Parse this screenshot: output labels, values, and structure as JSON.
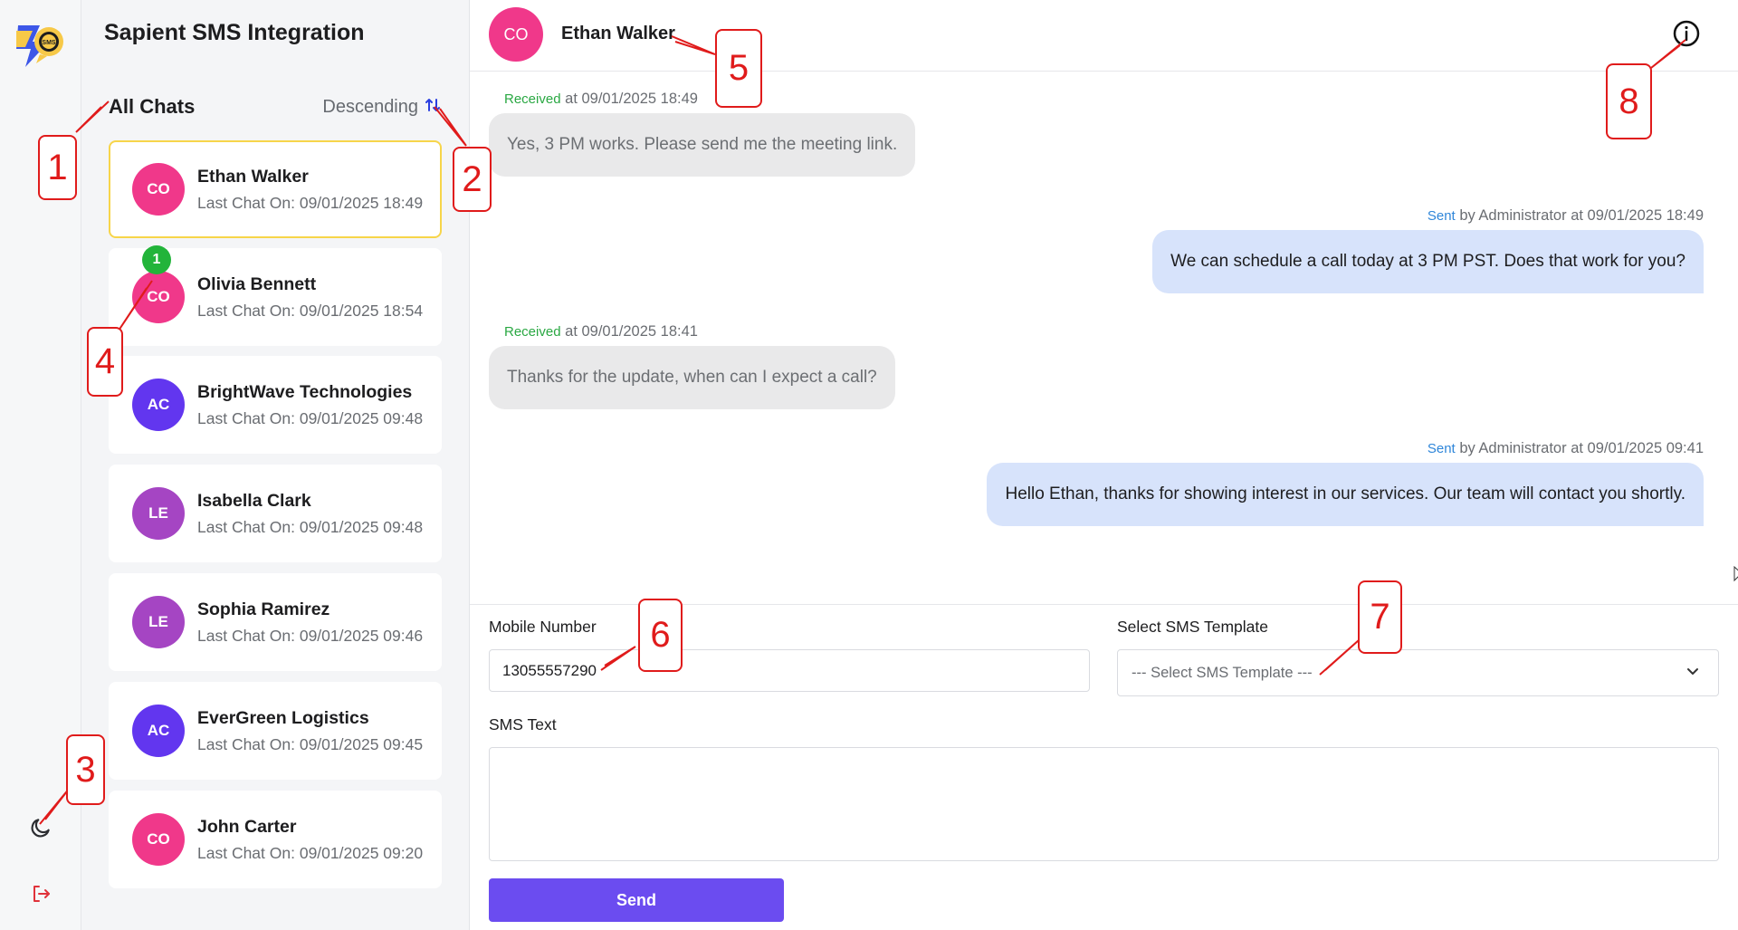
{
  "app": {
    "title": "Sapient SMS Integration",
    "logo_text": "SMS"
  },
  "rail": {
    "theme_icon": "moon-icon",
    "logout_icon": "logout-icon"
  },
  "list": {
    "heading": "All Chats",
    "sort_label": "Descending",
    "sort_icon": "sort-arrows-icon",
    "chats": [
      {
        "initials": "CO",
        "name": "Ethan Walker",
        "last": "Last Chat On: 09/01/2025 18:49",
        "color": "#f0388a",
        "active": true,
        "unread": ""
      },
      {
        "initials": "CO",
        "name": "Olivia Bennett",
        "last": "Last Chat On: 09/01/2025 18:54",
        "color": "#f0388a",
        "active": false,
        "unread": "1"
      },
      {
        "initials": "AC",
        "name": "BrightWave Technologies",
        "last": "Last Chat On: 09/01/2025 09:48",
        "color": "#6236ef",
        "active": false,
        "unread": ""
      },
      {
        "initials": "LE",
        "name": "Isabella Clark",
        "last": "Last Chat On: 09/01/2025 09:48",
        "color": "#a545c3",
        "active": false,
        "unread": ""
      },
      {
        "initials": "LE",
        "name": "Sophia Ramirez",
        "last": "Last Chat On: 09/01/2025 09:46",
        "color": "#a545c3",
        "active": false,
        "unread": ""
      },
      {
        "initials": "AC",
        "name": "EverGreen Logistics",
        "last": "Last Chat On: 09/01/2025 09:45",
        "color": "#6236ef",
        "active": false,
        "unread": ""
      },
      {
        "initials": "CO",
        "name": "John Carter",
        "last": "Last Chat On: 09/01/2025 09:20",
        "color": "#f0388a",
        "active": false,
        "unread": ""
      }
    ]
  },
  "conversation": {
    "contact_initials": "CO",
    "contact_name": "Ethan Walker",
    "info_icon": "info-icon",
    "messages": [
      {
        "direction": "in",
        "status": "Received",
        "meta": "at 09/01/2025 18:49",
        "text": "Yes, 3 PM works. Please send me the meeting link."
      },
      {
        "direction": "out",
        "status": "Sent",
        "meta": "by Administrator at 09/01/2025 18:49",
        "text": "We can schedule a call today at 3 PM PST. Does that work for you?"
      },
      {
        "direction": "in",
        "status": "Received",
        "meta": "at 09/01/2025 18:41",
        "text": "Thanks for the update, when can I expect a call?"
      },
      {
        "direction": "out",
        "status": "Sent",
        "meta": "by Administrator at 09/01/2025 09:41",
        "text": "Hello Ethan, thanks for showing interest in our services. Our team will contact you shortly."
      }
    ]
  },
  "composer": {
    "mobile_label": "Mobile Number",
    "mobile_value": "13055557290",
    "template_label": "Select SMS Template",
    "template_value": "--- Select SMS Template ---",
    "sms_label": "SMS Text",
    "sms_value": "",
    "send_label": "Send"
  },
  "annotations": [
    "1",
    "2",
    "3",
    "4",
    "5",
    "6",
    "7",
    "8"
  ],
  "colors": {
    "accent": "#6b4cf0",
    "annotation": "#e01b1b",
    "active_border": "#f7d54a",
    "received": "#2aa843",
    "sent": "#2f86d9"
  }
}
